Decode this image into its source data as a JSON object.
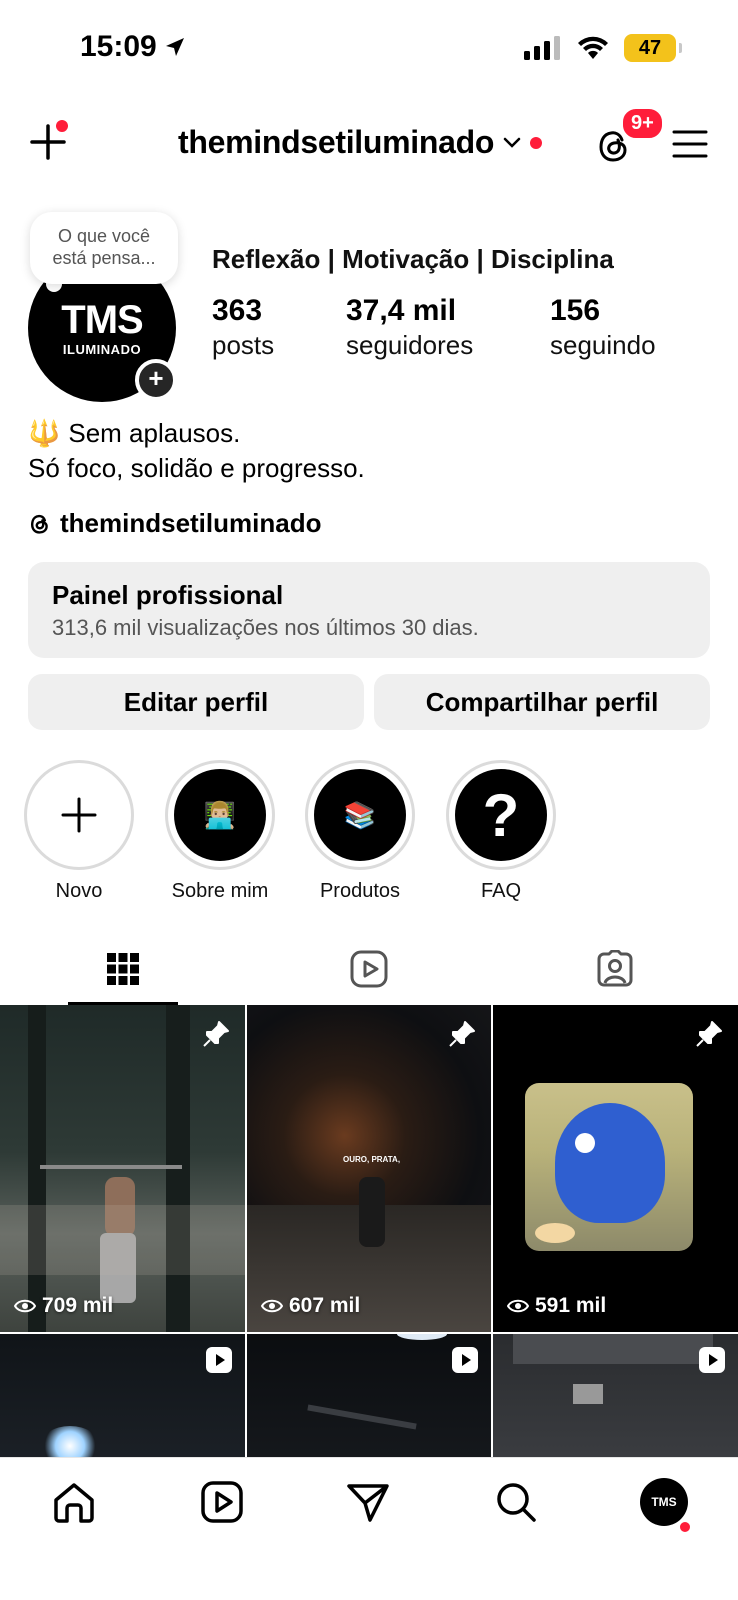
{
  "status_bar": {
    "time": "15:09",
    "battery": "47"
  },
  "header": {
    "username": "themindsetiluminado",
    "notif_badge": "9+"
  },
  "profile": {
    "avatar_main": "TMS",
    "avatar_sub": "ILUMINADO",
    "note_line1": "O que você",
    "note_line2": "está pensa...",
    "category": "Reflexão | Motivação | Disciplina",
    "stats": [
      {
        "value": "363",
        "label": "posts"
      },
      {
        "value": "37,4 mil",
        "label": "seguidores"
      },
      {
        "value": "156",
        "label": "seguindo"
      }
    ],
    "bio_emoji": "🔱",
    "bio_line1": "Sem aplausos.",
    "bio_line2": "Só foco, solidão e progresso.",
    "threads_handle": "themindsetiluminado"
  },
  "dashboard": {
    "title": "Painel profissional",
    "subtitle": "313,6 mil visualizações nos últimos 30 dias."
  },
  "actions": {
    "edit": "Editar perfil",
    "share": "Compartilhar perfil"
  },
  "highlights": [
    {
      "label": "Novo",
      "icon": "plus-icon"
    },
    {
      "label": "Sobre mim",
      "icon": "👨🏼‍💻"
    },
    {
      "label": "Produtos",
      "icon": "📚"
    },
    {
      "label": "FAQ",
      "icon": "?"
    }
  ],
  "posts": [
    {
      "views": "709 mil",
      "pinned": true
    },
    {
      "views": "607 mil",
      "pinned": true,
      "caption": "OURO, PRATA,"
    },
    {
      "views": "591 mil",
      "pinned": true
    },
    {
      "reel": true
    },
    {
      "reel": true
    },
    {
      "reel": true
    }
  ],
  "colors": {
    "accent_red": "#ff1d3a",
    "battery": "#f3c21b",
    "button_bg": "#efefef"
  }
}
